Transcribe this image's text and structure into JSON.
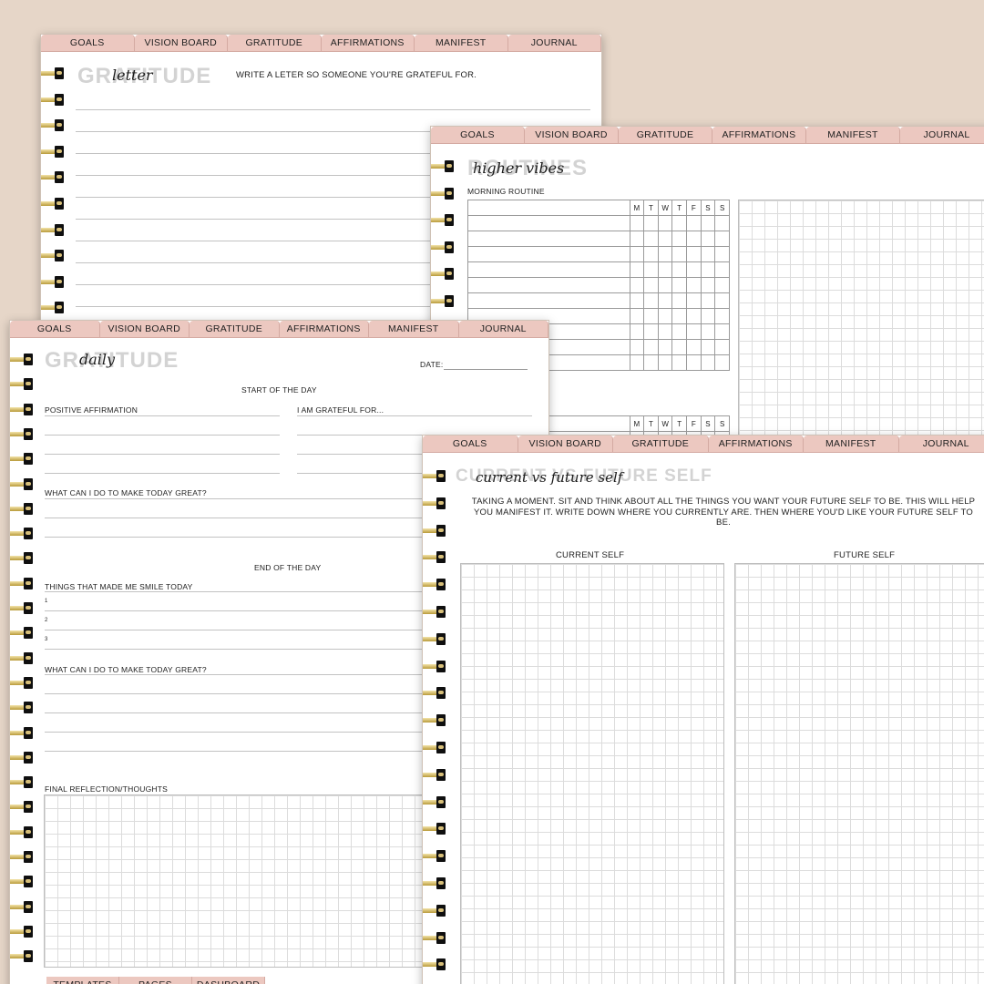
{
  "tabs": [
    "GOALS",
    "VISION BOARD",
    "GRATITUDE",
    "AFFIRMATIONS",
    "MANIFEST",
    "JOURNAL"
  ],
  "bottom_tabs": [
    "TEMPLATES",
    "PAGES",
    "DASHBOARD"
  ],
  "letter_page": {
    "big_title": "GRATITUDE",
    "script_title": "letter",
    "prompt": "WRITE A LETER SO SOMEONE YOU'RE GRATEFUL FOR."
  },
  "routines_page": {
    "big_title": "ROUTINES",
    "script_title": "higher vibes",
    "section_label": "MORNING ROUTINE",
    "days": [
      "M",
      "T",
      "W",
      "T",
      "F",
      "S",
      "S"
    ]
  },
  "daily_page": {
    "big_title": "GRATITUDE",
    "script_title": "daily",
    "date_label": "DATE:",
    "start_heading": "START OF THE DAY",
    "affirmation_label": "POSITIVE AFFIRMATION",
    "grateful_label": "I AM GRATEFUL FOR...",
    "great_question": "WHAT CAN I DO TO MAKE TODAY GREAT?",
    "end_heading": "END OF THE DAY",
    "smile_label": "THINGS THAT MADE ME SMILE TODAY",
    "smile_numbers": [
      "1",
      "2",
      "3"
    ],
    "great_question_2": "WHAT CAN I DO TO MAKE TODAY GREAT?",
    "reflection_label": "FINAL REFLECTION/THOUGHTS"
  },
  "self_page": {
    "big_title": "CURRENT VS FUTURE SELF",
    "script_title": "current vs future self",
    "instructions": "TAKING A MOMENT. SIT AND THINK ABOUT ALL THE THINGS YOU WANT YOUR FUTURE SELF TO BE. THIS WILL HELP YOU MANIFEST IT. WRITE DOWN WHERE YOU CURRENTLY ARE. THEN WHERE YOU'D LIKE YOUR FUTURE SELF TO BE.",
    "current_label": "CURRENT SELF",
    "future_label": "FUTURE SELF"
  },
  "colors": {
    "background": "#e6d6c8",
    "tab": "#ecc8c0",
    "ring_gold": "#d8c07a"
  }
}
